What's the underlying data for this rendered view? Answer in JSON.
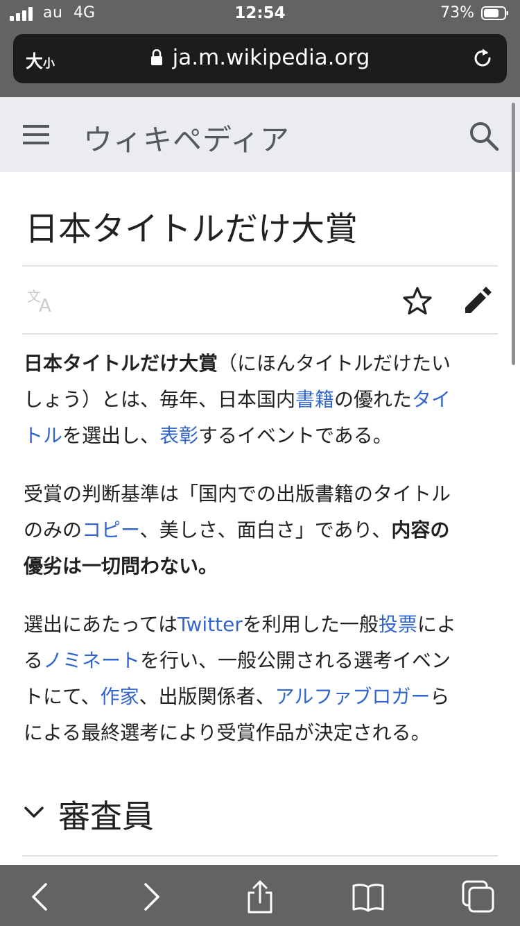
{
  "status_bar": {
    "carrier": "au",
    "network": "4G",
    "time": "12:54",
    "battery_percent": "73%"
  },
  "browser": {
    "text_size_label_big": "大",
    "text_size_label_small": "小",
    "url": "ja.m.wikipedia.org"
  },
  "wiki_header": {
    "logo_text": "ウィキペディア"
  },
  "article": {
    "title": "日本タイトルだけ大賞",
    "paragraphs": {
      "p1": {
        "l1_bold": "日本タイトルだけ大賞",
        "l1_rest": "（にほんタイトルだけたい",
        "l2_a": "しょう）とは、毎年、日本国内",
        "l2_link1": "書籍",
        "l2_b": "の優れた",
        "l2_link2": "タイ",
        "l3_link2": "トル",
        "l3_a": "を選出し、",
        "l3_link3": "表彰",
        "l3_b": "するイベントである。"
      },
      "p2": {
        "l1": "受賞の判断基準は「国内での出版書籍のタイトル",
        "l2_a": "のみの",
        "l2_link": "コピー",
        "l2_b": "、美しさ、面白さ」であり、",
        "l2_bold": "内容の",
        "l3_bold": "優劣は一切問わない",
        "l3_b": "。"
      },
      "p3": {
        "l1_a": "選出にあたっては",
        "l1_link1": "Twitter",
        "l1_b": "を利用した一般",
        "l1_link2": "投票",
        "l1_c": "によ",
        "l2_a": "る",
        "l2_link": "ノミネート",
        "l2_b": "を行い、一般公開される選考イベン",
        "l3_a": "トにて、",
        "l3_link1": "作家",
        "l3_b": "、出版関係者、",
        "l3_link2": "アルファブロガー",
        "l3_c": "ら",
        "l4": "による最終選考により受賞作品が決定される。"
      }
    },
    "section_heading": "審査員"
  },
  "colors": {
    "link": "#3366cc",
    "text": "#202122",
    "header_bg": "#eaecf0",
    "chrome_bg": "#636363"
  },
  "icons": [
    "signal-icon",
    "battery-icon",
    "lock-icon",
    "reload-icon",
    "menu-icon",
    "search-icon",
    "language-icon",
    "star-icon",
    "edit-icon",
    "chevron-down-icon",
    "back-icon",
    "forward-icon",
    "share-icon",
    "bookmarks-icon",
    "tabs-icon"
  ]
}
